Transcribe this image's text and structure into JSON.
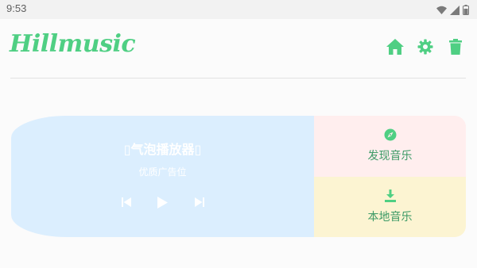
{
  "status_bar": {
    "time": "9:53",
    "icons": [
      "wifi-icon",
      "signal-icon",
      "battery-icon"
    ]
  },
  "header": {
    "logo": "Hillmusic",
    "actions": [
      "home-icon",
      "settings-icon",
      "trash-icon"
    ]
  },
  "player": {
    "title": "▯气泡播放器▯",
    "subtitle": "优质广告位",
    "controls": [
      "skip-previous-icon",
      "play-icon",
      "skip-next-icon"
    ]
  },
  "side": {
    "discover_label": "发现音乐",
    "local_label": "本地音乐"
  },
  "colors": {
    "accent": "#4fcf83",
    "player_bg": "#dbeefe",
    "discover_bg": "#ffeeee",
    "local_bg": "#fcf4d2",
    "label": "#3c9a66"
  }
}
